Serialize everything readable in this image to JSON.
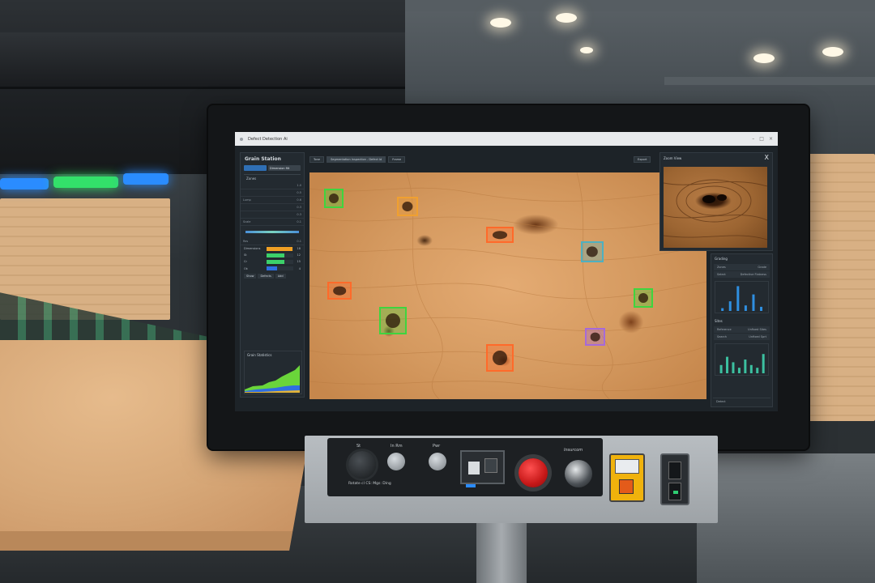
{
  "window": {
    "title": "Defect Detection Ai"
  },
  "left_panel": {
    "title": "Grain Station",
    "btn_active": "",
    "btn_plain": "Dimension filt",
    "section1": "Zones",
    "rows": [
      {
        "label": "",
        "value": "1.0"
      },
      {
        "label": "",
        "value": "0.5"
      },
      {
        "label": "Lump",
        "value": "0.6"
      },
      {
        "label": "",
        "value": "0.3"
      },
      {
        "label": "",
        "value": "0.3"
      },
      {
        "label": "Scale",
        "value": "0.1"
      }
    ],
    "stats_header": {
      "label": "Res",
      "value": "0.1"
    },
    "defects": [
      {
        "name": "Dimensions",
        "fraction": 0.95,
        "color": "#f0a024",
        "count": "18"
      },
      {
        "name": "St",
        "fraction": 0.65,
        "color": "#3cd06a",
        "count": "12"
      },
      {
        "name": "Cr",
        "fraction": 0.65,
        "color": "#3cd06a",
        "count": "15"
      },
      {
        "name": "Ok",
        "fraction": 0.4,
        "color": "#2f6fe0",
        "count": "4"
      }
    ],
    "tabs": [
      "Show",
      "Defects",
      "Add"
    ],
    "trend": {
      "title": "Grain Statistics"
    }
  },
  "image_tabs": [
    "Tone",
    "Segmentation Inspection - Defect Id",
    "Frame"
  ],
  "image_toolbar": [
    "Export"
  ],
  "detections": [
    {
      "id": 1,
      "type": "knot",
      "color": "#3fd43f"
    },
    {
      "id": 2,
      "type": "resin",
      "color": "#f0a030"
    },
    {
      "id": 3,
      "type": "crack",
      "color": "#ff6a2a"
    },
    {
      "id": 4,
      "type": "stain",
      "color": "#4fb0c0"
    },
    {
      "id": 5,
      "type": "knot",
      "color": "#ff6a2a"
    },
    {
      "id": 6,
      "type": "hole",
      "color": "#3fd43f"
    },
    {
      "id": 7,
      "type": "knot",
      "color": "#3fd43f"
    },
    {
      "id": 8,
      "type": "patch",
      "color": "#a66ad8"
    },
    {
      "id": 9,
      "type": "crack",
      "color": "#ff6a2a"
    }
  ],
  "zoom_panel": {
    "title": "Zoom View",
    "close": "X"
  },
  "right_panel": {
    "head": "Grading",
    "rows": [
      {
        "label": "Zones",
        "value": "Grade"
      },
      {
        "label": "Select",
        "value": "Defective Flatness"
      }
    ],
    "chart1": [
      0.1,
      0.35,
      0.9,
      0.2,
      0.6,
      0.15
    ],
    "section2": "Sites",
    "rows2": [
      {
        "label": "Reference",
        "value": "Unfixed Sites"
      },
      {
        "label": "Search",
        "value": "Unfixed Sprt"
      }
    ],
    "chart2": [
      0.3,
      0.6,
      0.4,
      0.2,
      0.5,
      0.3,
      0.2,
      0.7
    ],
    "footer": "Detect"
  },
  "control_panel": {
    "labels": [
      "St",
      "In Rm",
      "Pwr",
      "Insurcom"
    ],
    "caption": "Rotate cl CS: Mgs: Ding"
  },
  "colors": {
    "accent": "#2f6fb5",
    "screen_bg": "#1d2328",
    "estop": "#d81e1e"
  }
}
